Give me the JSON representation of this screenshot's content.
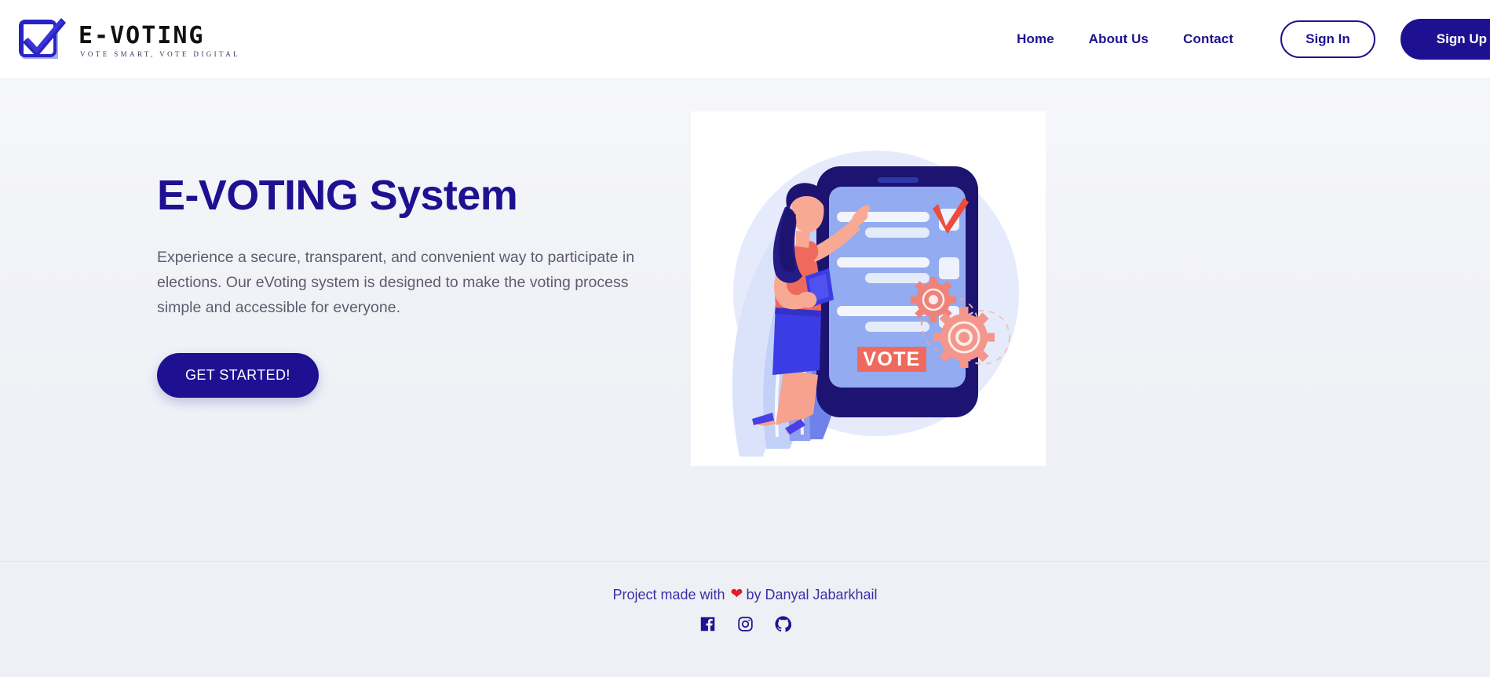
{
  "brand": {
    "name": "E-VOTING",
    "tagline": "VOTE SMART, VOTE DIGITAL",
    "logo_icon": "checkbox-check-icon",
    "logo_color": "#2a22c4"
  },
  "nav": {
    "links": [
      {
        "label": "Home",
        "name": "nav-link-home"
      },
      {
        "label": "About Us",
        "name": "nav-link-about-us"
      },
      {
        "label": "Contact",
        "name": "nav-link-contact"
      }
    ],
    "sign_in_label": "Sign In",
    "sign_up_label": "Sign Up"
  },
  "hero": {
    "title": "E-VOTING System",
    "description": "Experience a secure, transparent, and convenient way to participate in elections. Our eVoting system is designed to make the voting process simple and accessible for everyone.",
    "cta_label": "GET STARTED!",
    "illustration": {
      "name": "online-voting-illustration",
      "vote_button_label": "VOTE",
      "alt": "Woman pointing at a tablet showing a ballot with a checkmark and gears"
    }
  },
  "footer": {
    "credit_prefix": "Project made with",
    "heart_icon": "heart-icon",
    "credit_suffix": "by Danyal Jabarkhail",
    "socials": [
      {
        "label": "Facebook",
        "name": "social-facebook-icon"
      },
      {
        "label": "Instagram",
        "name": "social-instagram-icon"
      },
      {
        "label": "GitHub",
        "name": "social-github-icon"
      }
    ]
  },
  "colors": {
    "primary": "#1e1191",
    "accent_red": "#e8192c",
    "illustration_coral": "#f4776a",
    "illustration_blue": "#4a5be0",
    "hero_bg": "#f1f2f7",
    "footer_bg": "#eff0f5"
  }
}
